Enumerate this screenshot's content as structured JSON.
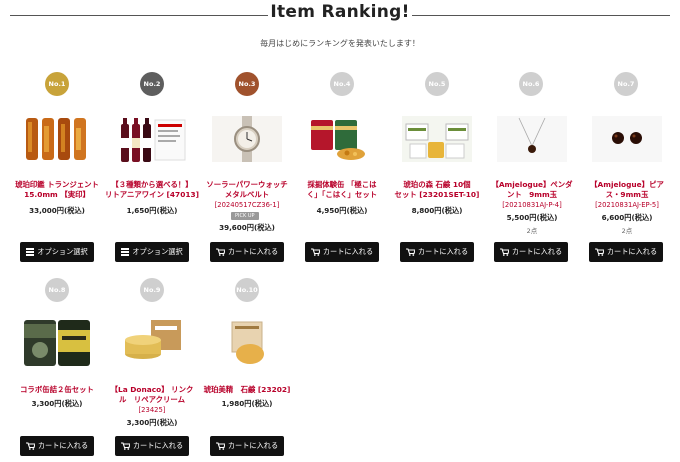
{
  "header": {
    "title": "Item Ranking!",
    "subtitle": "毎月はじめにランキングを発表いたします！"
  },
  "colors": {
    "gold": "#c8a33a",
    "silver": "#5e5e5e",
    "bronze": "#a0522d",
    "rank_default": "#cfcfcf",
    "product_red": "#b8002a",
    "button": "#111111"
  },
  "items": [
    {
      "rank": "No.1",
      "name_line1": "琥珀印鑑 トランジェント",
      "name_line2": "15.0mm 【実印】",
      "code": "",
      "price": "33,000円(税込)",
      "button_label": "オプション選択",
      "button_icon": "list-icon",
      "pickup": "",
      "count": ""
    },
    {
      "rank": "No.2",
      "name_line1": "【３種類から選べる！】",
      "name_line2": "リトアニアワイン [47013]",
      "code": "",
      "price": "1,650円(税込)",
      "button_label": "オプション選択",
      "button_icon": "list-icon",
      "pickup": "",
      "count": ""
    },
    {
      "rank": "No.3",
      "name_line1": "ソーラーパワーウォッチ",
      "name_line2": "メタルベルト",
      "code": "[20240517CZ36-1]",
      "price": "39,600円(税込)",
      "button_label": "カートに入れる",
      "button_icon": "cart-icon",
      "pickup": "PICK UP",
      "count": ""
    },
    {
      "rank": "No.4",
      "name_line1": "採掘体験缶 「極こは",
      "name_line2": "く」「こはく」セット",
      "code": "",
      "price": "4,950円(税込)",
      "button_label": "カートに入れる",
      "button_icon": "cart-icon",
      "pickup": "",
      "count": ""
    },
    {
      "rank": "No.5",
      "name_line1": "琥珀の森 石鹸 10個",
      "name_line2": "セット [23201SET-10]",
      "code": "",
      "price": "8,800円(税込)",
      "button_label": "カートに入れる",
      "button_icon": "cart-icon",
      "pickup": "",
      "count": ""
    },
    {
      "rank": "No.6",
      "name_line1": "【Amjelogue】ペンダ",
      "name_line2": "ント　9mm玉",
      "code": "[20210831AJ-P-4]",
      "price": "5,500円(税込)",
      "button_label": "カートに入れる",
      "button_icon": "cart-icon",
      "pickup": "",
      "count": "2点"
    },
    {
      "rank": "No.7",
      "name_line1": "【Amjelogue】ピア",
      "name_line2": "ス・9mm玉",
      "code": "[20210831AJ-EP-5]",
      "price": "6,600円(税込)",
      "button_label": "カートに入れる",
      "button_icon": "cart-icon",
      "pickup": "",
      "count": "2点"
    },
    {
      "rank": "No.8",
      "name_line1": "コラボ缶詰２缶セット",
      "name_line2": "",
      "code": "",
      "price": "3,300円(税込)",
      "button_label": "カートに入れる",
      "button_icon": "cart-icon",
      "pickup": "",
      "count": ""
    },
    {
      "rank": "No.9",
      "name_line1": "【La Donaco】 リンク",
      "name_line2": "ル　リペアクリーム",
      "code": "[23425]",
      "price": "3,300円(税込)",
      "button_label": "カートに入れる",
      "button_icon": "cart-icon",
      "pickup": "",
      "count": ""
    },
    {
      "rank": "No.10",
      "name_line1": "琥珀美精　石鹸 [23202]",
      "name_line2": "",
      "code": "",
      "price": "1,980円(税込)",
      "button_label": "カートに入れる",
      "button_icon": "cart-icon",
      "pickup": "",
      "count": ""
    }
  ]
}
